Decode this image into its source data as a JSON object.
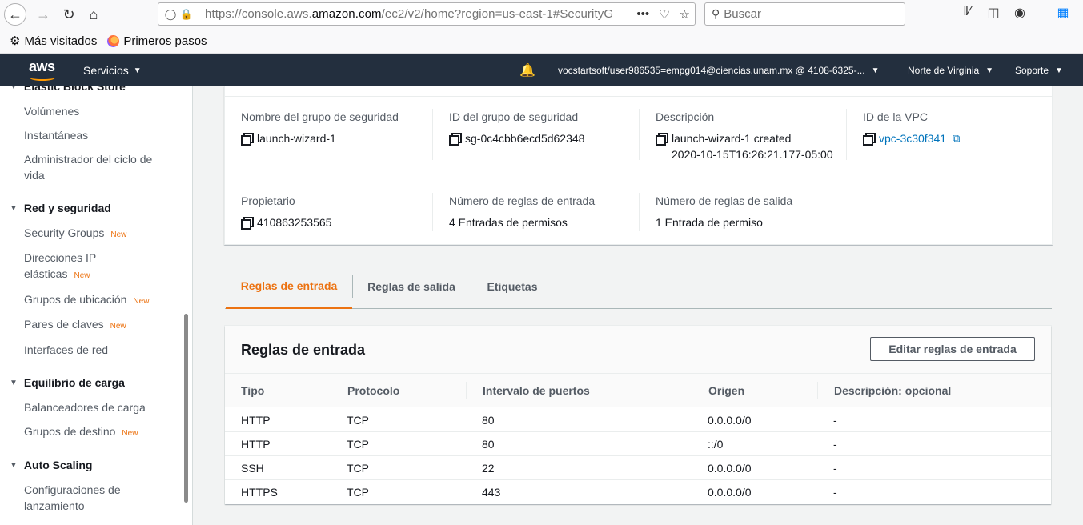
{
  "browser": {
    "url_prefix": "https://console.aws.",
    "url_domain": "amazon.com",
    "url_suffix": "/ec2/v2/home?region=us-east-1#SecurityG",
    "search_placeholder": "Buscar",
    "bookmarks": [
      {
        "label": "Más visitados",
        "icon": "gear-icon"
      },
      {
        "label": "Primeros pasos",
        "icon": "firefox-icon"
      }
    ]
  },
  "aws_nav": {
    "logo": "aws",
    "services_label": "Servicios",
    "account": "vocstartsoft/user986535=empg014@ciencias.unam.mx @ 4108-6325-...",
    "region": "Norte de Virginia",
    "support": "Soporte"
  },
  "sidebar": {
    "sections": [
      {
        "title": "Elastic Block Store",
        "items": [
          {
            "label": "Volúmenes",
            "new": ""
          },
          {
            "label": "Instantáneas",
            "new": ""
          },
          {
            "label": "Administrador del ciclo de",
            "label2": "vida",
            "new": ""
          }
        ]
      },
      {
        "title": "Red y seguridad",
        "items": [
          {
            "label": "Security Groups",
            "new": "New"
          },
          {
            "label": "Direcciones IP",
            "label2": "elásticas",
            "new": "New"
          },
          {
            "label": "Grupos de ubicación",
            "new": "New"
          },
          {
            "label": "Pares de claves",
            "new": "New"
          },
          {
            "label": "Interfaces de red",
            "new": ""
          }
        ]
      },
      {
        "title": "Equilibrio de carga",
        "items": [
          {
            "label": "Balanceadores de carga",
            "new": ""
          },
          {
            "label": "Grupos de destino",
            "new": "New"
          }
        ]
      },
      {
        "title": "Auto Scaling",
        "items": [
          {
            "label": "Configuraciones de",
            "label2": "lanzamiento",
            "new": ""
          }
        ]
      }
    ]
  },
  "details": {
    "name_label": "Nombre del grupo de seguridad",
    "name_value": "launch-wizard-1",
    "id_label": "ID del grupo de seguridad",
    "id_value": "sg-0c4cbb6ecd5d62348",
    "desc_label": "Descripción",
    "desc_value_1": "launch-wizard-1 created",
    "desc_value_2": "2020-10-15T16:26:21.177-05:00",
    "vpc_label": "ID de la VPC",
    "vpc_value": "vpc-3c30f341",
    "owner_label": "Propietario",
    "owner_value": "410863253565",
    "inbound_count_label": "Número de reglas de entrada",
    "inbound_count_value": "4 Entradas de permisos",
    "outbound_count_label": "Número de reglas de salida",
    "outbound_count_value": "1 Entrada de permiso"
  },
  "tabs": [
    {
      "label": "Reglas de entrada",
      "active": true
    },
    {
      "label": "Reglas de salida",
      "active": false
    },
    {
      "label": "Etiquetas",
      "active": false
    }
  ],
  "rules": {
    "title": "Reglas de entrada",
    "edit_button": "Editar reglas de entrada",
    "columns": [
      "Tipo",
      "Protocolo",
      "Intervalo de puertos",
      "Origen",
      "Descripción: opcional"
    ],
    "rows": [
      [
        "HTTP",
        "TCP",
        "80",
        "0.0.0.0/0",
        "-"
      ],
      [
        "HTTP",
        "TCP",
        "80",
        "::/0",
        "-"
      ],
      [
        "SSH",
        "TCP",
        "22",
        "0.0.0.0/0",
        "-"
      ],
      [
        "HTTPS",
        "TCP",
        "443",
        "0.0.0.0/0",
        "-"
      ]
    ]
  },
  "colors": {
    "aws_nav_bg": "#232f3e",
    "accent_orange": "#ec7211",
    "link_blue": "#0073bb"
  }
}
